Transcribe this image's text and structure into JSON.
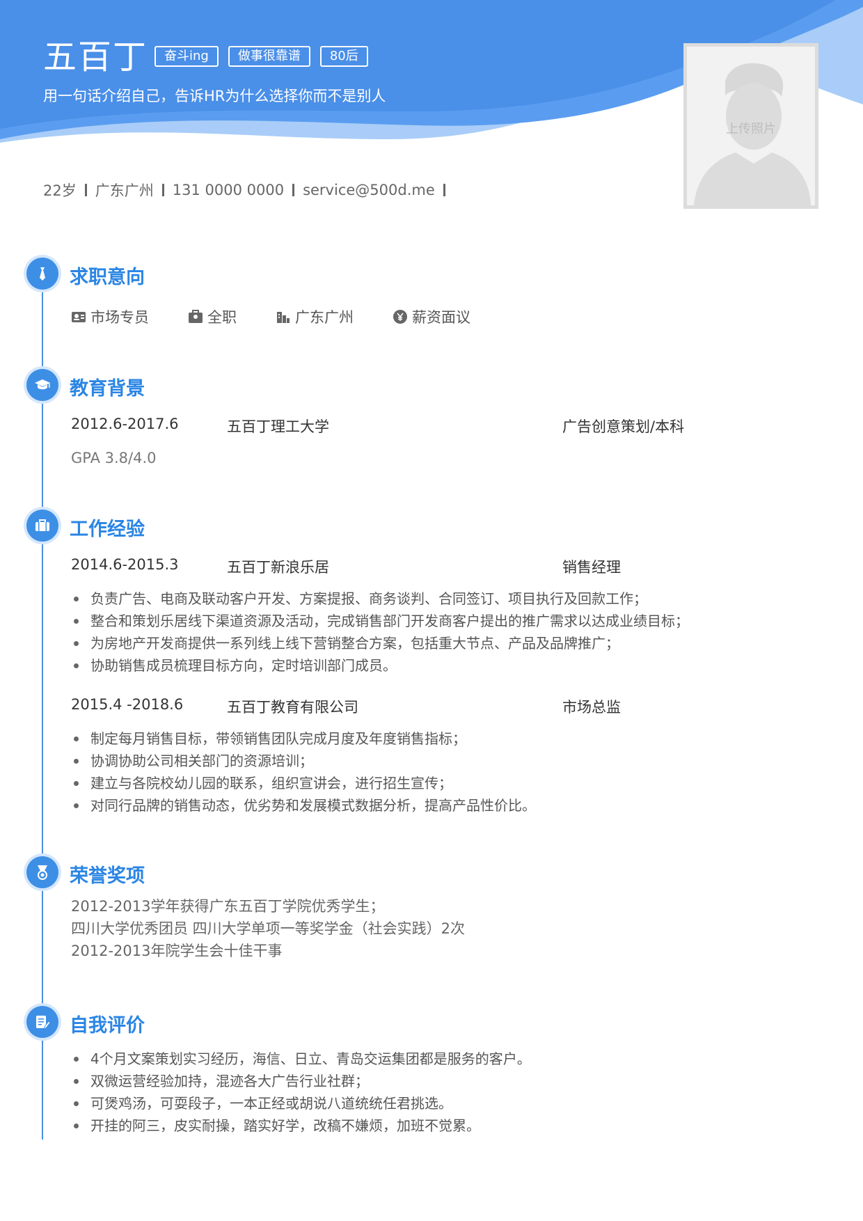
{
  "header": {
    "name": "五百丁",
    "tags": [
      "奋斗ing",
      "做事很靠谱",
      "80后"
    ],
    "motto": "用一句话介绍自己，告诉HR为什么选择你而不是别人",
    "photo_label": "上传照片",
    "colors": {
      "primary": "#3d8fe6",
      "wave_light": "#a9cdf8",
      "accent_text": "#2a85e4"
    }
  },
  "contact": [
    "22岁",
    "广东广州",
    "131 0000 0000",
    "service@500d.me"
  ],
  "sections": {
    "intent": {
      "title": "求职意向",
      "icon": "tie-icon",
      "items": [
        {
          "icon": "id-card-icon",
          "label": "市场专员"
        },
        {
          "icon": "briefcase-icon",
          "label": "全职"
        },
        {
          "icon": "building-icon",
          "label": "广东广州"
        },
        {
          "icon": "yen-icon",
          "label": "薪资面议"
        }
      ]
    },
    "education": {
      "title": "教育背景",
      "icon": "graduation-cap-icon",
      "date": "2012.6-2017.6",
      "school": "五百丁理工大学",
      "major": "广告创意策划/本科",
      "gpa": "GPA 3.8/4.0"
    },
    "work": {
      "title": "工作经验",
      "icon": "briefcase-icon",
      "jobs": [
        {
          "date": "2014.6-2015.3",
          "company": "五百丁新浪乐居",
          "role": "销售经理",
          "duties": [
            "负责广告、电商及联动客户开发、方案提报、商务谈判、合同签订、项目执行及回款工作；",
            "整合和策划乐居线下渠道资源及活动，完成销售部门开发商客户提出的推广需求以达成业绩目标；",
            "为房地产开发商提供一系列线上线下营销整合方案，包括重大节点、产品及品牌推广；",
            "协助销售成员梳理目标方向，定时培训部门成员。"
          ]
        },
        {
          "date": "2015.4 -2018.6",
          "company": "五百丁教育有限公司",
          "role": "市场总监",
          "duties": [
            "制定每月销售目标，带领销售团队完成月度及年度销售指标；",
            "协调协助公司相关部门的资源培训；",
            "建立与各院校幼儿园的联系，组织宣讲会，进行招生宣传；",
            "对同行品牌的销售动态，优劣势和发展模式数据分析，提高产品性价比。"
          ]
        }
      ]
    },
    "honors": {
      "title": "荣誉奖项",
      "icon": "medal-icon",
      "items": [
        "2012-2013学年获得广东五百丁学院优秀学生；",
        "四川大学优秀团员 四川大学单项一等奖学金（社会实践）2次",
        "2012-2013年院学生会十佳干事"
      ]
    },
    "self": {
      "title": "自我评价",
      "icon": "edit-note-icon",
      "items": [
        "4个月文案策划实习经历，海信、日立、青岛交运集团都是服务的客户。",
        "双微运营经验加持，混迹各大广告行业社群；",
        "可煲鸡汤，可耍段子，一本正经或胡说八道统统任君挑选。",
        "开挂的阿三，皮实耐操，踏实好学，改稿不嫌烦，加班不觉累。"
      ]
    }
  }
}
